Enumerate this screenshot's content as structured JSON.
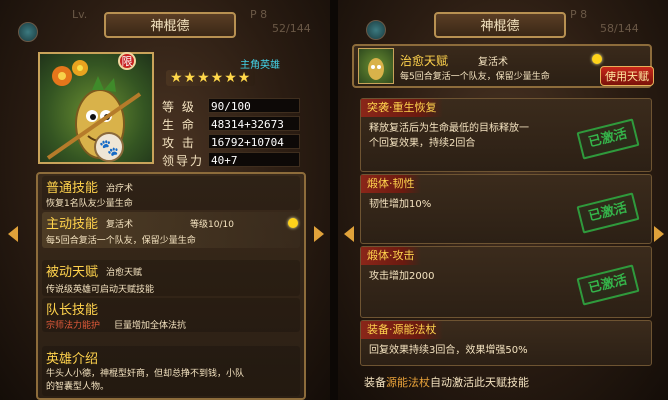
{
  "left": {
    "title": "神棍德",
    "limit_badge": "限",
    "role": "主角英雄",
    "stars": "★★★★★★",
    "stats": [
      {
        "label": "等 级",
        "value": "90/100"
      },
      {
        "label": "生 命",
        "value": "48314+32673"
      },
      {
        "label": "攻 击",
        "value": "16792+10704"
      },
      {
        "label": "领导力",
        "value": "40+7"
      }
    ],
    "normal_skill": {
      "title": "普通技能",
      "name": "治疗术",
      "desc": "恢复1名队友少量生命"
    },
    "active_skill": {
      "title": "主动技能",
      "name": "复活术",
      "level": "等级10/10",
      "desc": "每5回合复活一个队友，保留少量生命"
    },
    "passive_talent": {
      "title": "被动天赋",
      "name": "治愈天赋",
      "desc": "传说级英雄可启动天赋技能"
    },
    "captain_skill": {
      "title": "队长技能",
      "name": "宗师法力能护",
      "desc": "巨量增加全体法抗"
    },
    "intro": {
      "title": "英雄介绍",
      "line1": "牛头人小德，神棍型奸商，但却总挣不到钱，小队",
      "line2": "的智囊型人物。"
    },
    "ghost_top": "Lv.",
    "ghost_p": "P 8",
    "ghost_count": "52/144"
  },
  "right": {
    "title": "神棍德",
    "skill_name": "治愈天赋",
    "skill_sub": "复活术",
    "skill_desc": "每5回合复活一个队友，保留少量生命",
    "use_button": "使用天赋",
    "ghost_p": "P 8",
    "ghost_count": "58/144",
    "talents": [
      {
        "title": "突袭·重生恢复",
        "line1": "释放复活后为生命最低的目标释放一",
        "line2": "个回复效果，持续2回合",
        "status": "已激活"
      },
      {
        "title": "煅体·韧性",
        "line1": "韧性增加10%",
        "line2": "",
        "status": "已激活"
      },
      {
        "title": "煅体·攻击",
        "line1": "攻击增加2000",
        "line2": "",
        "status": "已激活"
      },
      {
        "title": "装备·源能法杖",
        "line1": "回复效果持续3回合，效果增强50%",
        "line2": "",
        "status": ""
      }
    ],
    "footer_prefix": "装备",
    "footer_highlight": "源能法杖",
    "footer_suffix": "自动激活此天赋技能"
  }
}
